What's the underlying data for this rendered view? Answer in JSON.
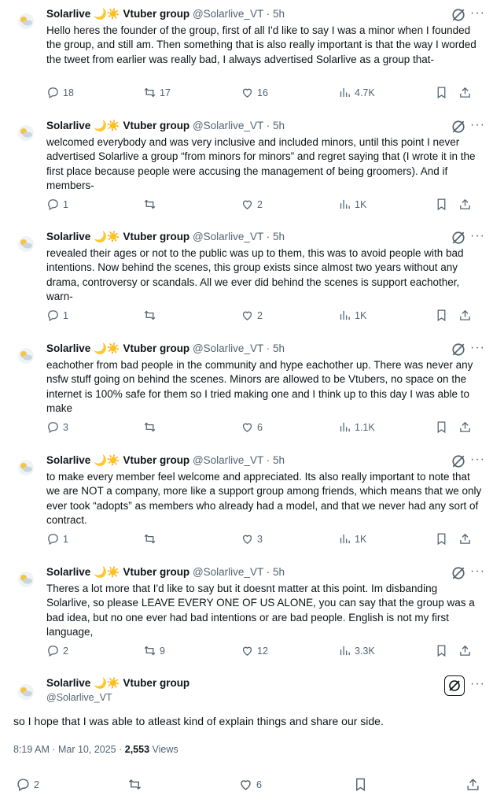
{
  "author": {
    "name": "Solarlive",
    "emoji_moon": "🌙",
    "emoji_sun": "☀️",
    "group_label": "Vtuber group",
    "handle": "@Solarlive_VT",
    "time": "· 5h"
  },
  "thread": [
    {
      "text": "Hello heres the founder of the group, first of all I'd like to say I was a minor when I founded the group, and still am. Then something that is also really important is that the way I worded the tweet from earlier was really bad, I always advertised Solarlive as a group that-",
      "replies": "18",
      "reposts": "17",
      "likes": "16",
      "views": "4.7K"
    },
    {
      "text": "welcomed everybody and was very inclusive and included minors, until this point I never advertised Solarlive a group “from minors for minors” and regret saying that (I wrote it in the first place because people were accusing the management of being groomers). And if members-",
      "replies": "1",
      "reposts": "",
      "likes": "2",
      "views": "1K"
    },
    {
      "text": "revealed their ages or not to the public was up to them, this was to avoid people with bad intentions. Now behind the scenes, this group exists since almost two years without any drama, controversy or scandals. All we ever did behind the scenes is support eachother, warn-",
      "replies": "1",
      "reposts": "",
      "likes": "2",
      "views": "1K"
    },
    {
      "text": "eachother from bad people in the community and hype eachother up. There was never any nsfw stuff going on behind the scenes. Minors are allowed to be Vtubers, no space on the internet is 100% safe for them so I tried making one and I think up to this day I was able to make",
      "replies": "3",
      "reposts": "",
      "likes": "6",
      "views": "1.1K"
    },
    {
      "text": "to make every member feel welcome and appreciated. Its also really important to note that we are NOT a company, more like a support group among friends, which means that we only ever took “adopts” as members who already had a model, and that we never had any sort of contract.",
      "replies": "1",
      "reposts": "",
      "likes": "3",
      "views": "1K"
    },
    {
      "text": "Theres a lot more that I'd like to say but it doesnt matter at this point. Im disbanding Solarlive, so please LEAVE EVERY ONE OF US ALONE, you can say that the group was a bad idea, but no one ever had bad intentions or are bad people. English is not my first language,",
      "replies": "2",
      "reposts": "9",
      "likes": "12",
      "views": "3.3K"
    }
  ],
  "main_tweet": {
    "text": "so I hope that I was able to atleast kind of explain things and share our side.",
    "timestamp": "8:19 AM · Mar 10, 2025 ·",
    "views_count": "2,553",
    "views_label": "Views",
    "replies": "2",
    "reposts": "",
    "likes": "6"
  },
  "icons": {
    "reply": "reply-icon",
    "repost": "repost-icon",
    "like": "heart-icon",
    "views": "analytics-icon",
    "bookmark": "bookmark-icon",
    "share": "share-icon",
    "grok": "grok-icon",
    "more": "more-icon"
  },
  "colors": {
    "muted": "#536471",
    "text": "#0f1419"
  }
}
